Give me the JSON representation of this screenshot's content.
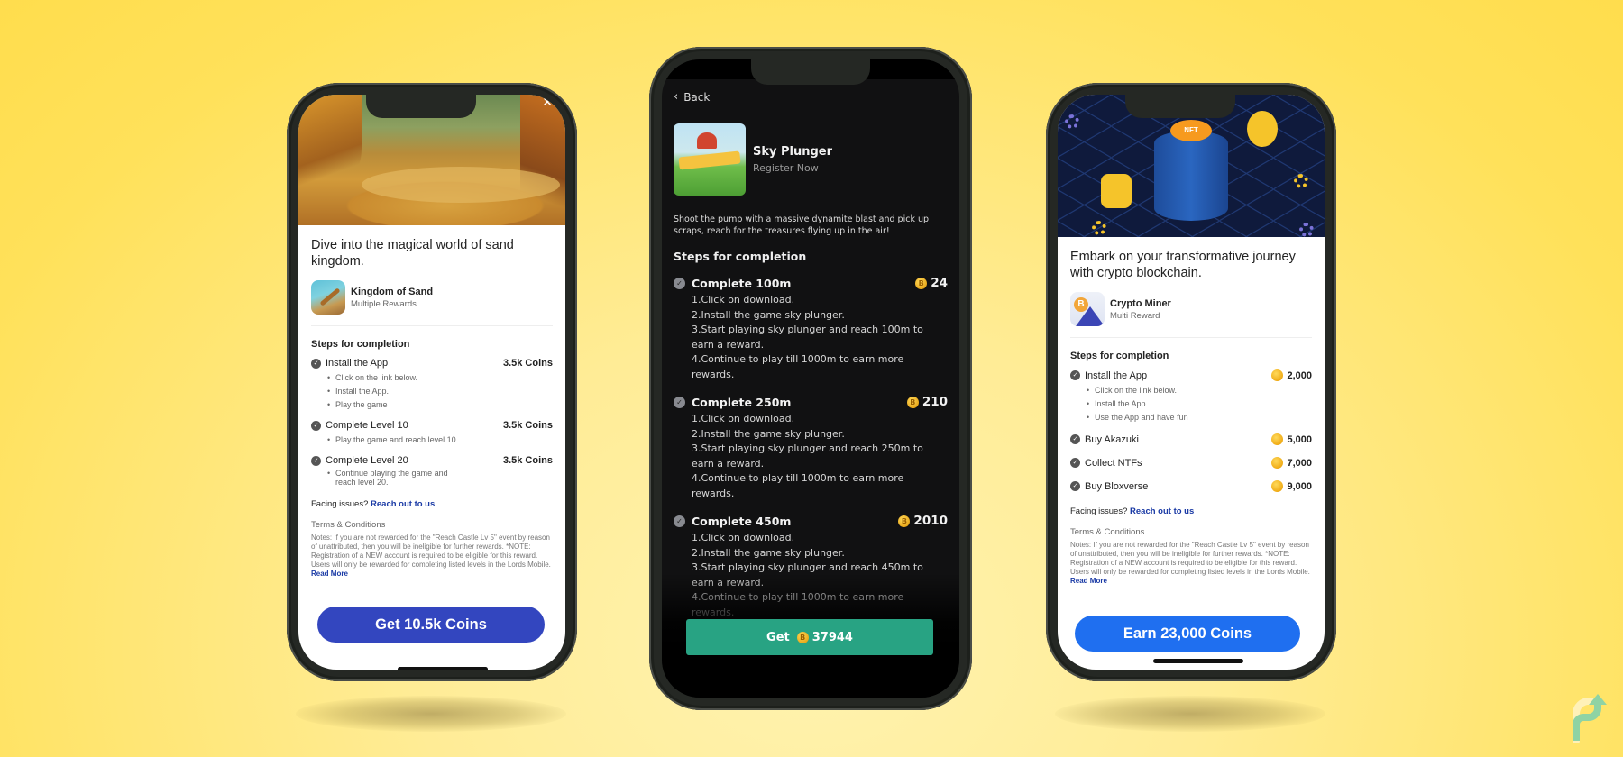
{
  "colors": {
    "background": "#ffe15a",
    "left_cta": "#3346bf",
    "right_cta": "#1f6ff0",
    "center_cta": "#28a383",
    "link": "#1a3aa5",
    "coin": "#f0ac17",
    "brand_logo": "#8fd3a4"
  },
  "left_phone": {
    "close_icon": "✕",
    "headline": "Dive into the magical world of sand kingdom.",
    "app": {
      "name": "Kingdom of Sand",
      "subtitle": "Multiple Rewards"
    },
    "steps_title": "Steps for completion",
    "steps": [
      {
        "label": "Install the App",
        "reward": "3.5k Coins",
        "bullets": [
          "Click on the link below.",
          "Install the App.",
          "Play the game"
        ]
      },
      {
        "label": "Complete Level 10",
        "reward": "3.5k Coins",
        "bullets": [
          "Play the game and reach level 10."
        ]
      },
      {
        "label": "Complete Level 20",
        "reward": "3.5k Coins",
        "bullets": [
          "Continue playing the game and reach level 20."
        ]
      }
    ],
    "facing_issues": "Facing issues?",
    "reach_out": "Reach out to us",
    "terms_title": "Terms & Conditions",
    "terms_body": "Notes: If you are not rewarded for the \"Reach Castle Lv 5\" event by reason of unattributed, then you will be ineligible for further rewards. *NOTE: Registration of a NEW account is required to be eligible for this reward. Users will only be rewarded for completing listed levels in the Lords Mobile.",
    "read_more": "Read More",
    "cta_label": "Get 10.5k Coins"
  },
  "center_phone": {
    "back_label": "Back",
    "app": {
      "name": "Sky Plunger",
      "subtitle": "Register Now"
    },
    "description": "Shoot the pump with a massive dynamite blast and pick up scraps, reach for the treasures flying up in the air!",
    "steps_title": "Steps for completion",
    "steps": [
      {
        "title": "Complete 100m",
        "reward": "24",
        "lines": [
          "1.Click on download.",
          "2.Install the game sky plunger.",
          "3.Start playing sky plunger and reach 100m to earn a reward.",
          "4.Continue to play till 1000m to earn more rewards."
        ]
      },
      {
        "title": "Complete 250m",
        "reward": "210",
        "lines": [
          "1.Click on download.",
          "2.Install the game sky plunger.",
          "3.Start playing sky plunger and reach 250m to earn a reward.",
          "4.Continue to play till 1000m to earn more rewards."
        ]
      },
      {
        "title": "Complete 450m",
        "reward": "2010",
        "lines": [
          "1.Click on download.",
          "2.Install the game sky plunger.",
          "3.Start playing sky plunger and reach 450m to earn a reward.",
          "4.Continue to play till 1000m to earn more rewards."
        ]
      }
    ],
    "cta_prefix": "Get",
    "cta_amount": "37944",
    "coin_symbol": "B"
  },
  "right_phone": {
    "headline": "Embark on your transformative journey with crypto blockchain.",
    "app": {
      "name": "Crypto Miner",
      "subtitle": "Multi Reward",
      "icon_symbol": "B"
    },
    "banner_badge": "NFT",
    "steps_title": "Steps for completion",
    "steps": [
      {
        "label": "Install the App",
        "reward": "2,000",
        "bullets": [
          "Click on the link below.",
          "Install the App.",
          "Use the App and have fun"
        ]
      },
      {
        "label": "Buy Akazuki",
        "reward": "5,000",
        "bullets": []
      },
      {
        "label": "Collect NTFs",
        "reward": "7,000",
        "bullets": []
      },
      {
        "label": "Buy Bloxverse",
        "reward": "9,000",
        "bullets": []
      }
    ],
    "facing_issues": "Facing issues?",
    "reach_out": "Reach out to us",
    "terms_title": "Terms & Conditions",
    "terms_body": "Notes: If you are not rewarded for the \"Reach Castle Lv 5\" event by reason of unattributed, then you will be ineligible for further rewards. *NOTE: Registration of a NEW account is required to be eligible for this reward. Users will only be rewarded for completing listed levels in the Lords Mobile.",
    "read_more": "Read More",
    "cta_label": "Earn 23,000 Coins"
  }
}
